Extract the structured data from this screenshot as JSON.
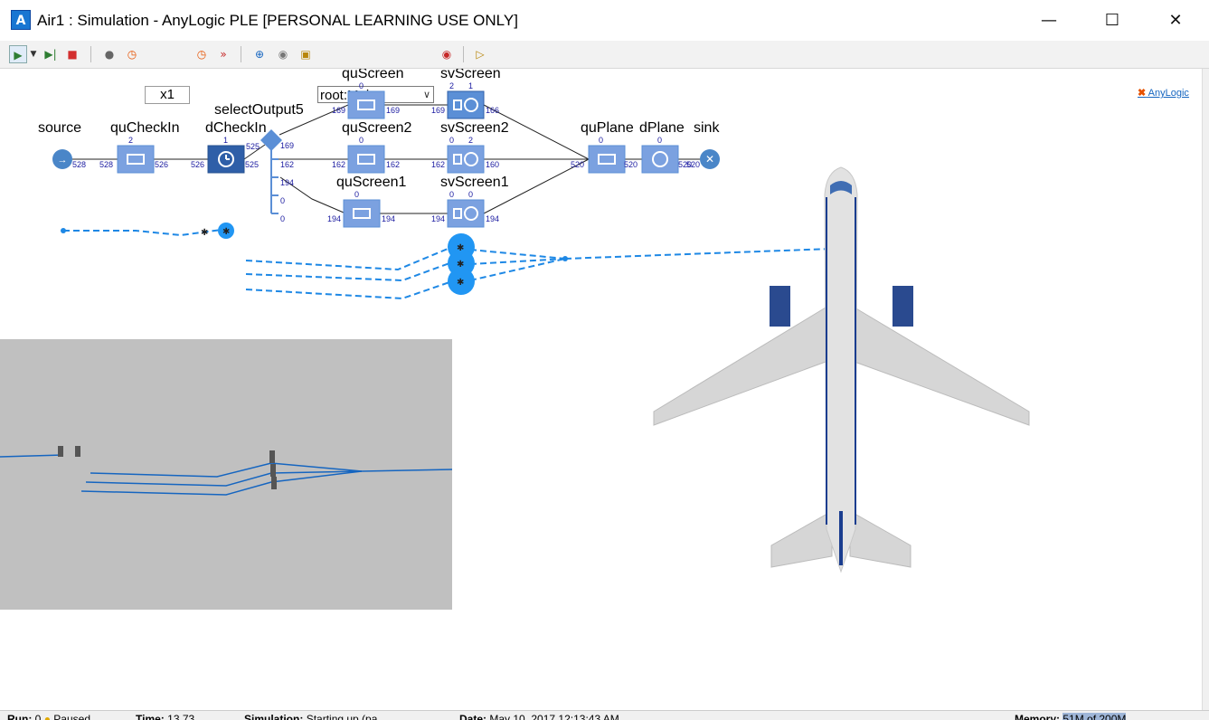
{
  "window": {
    "title": "Air1 : Simulation - AnyLogic PLE [PERSONAL LEARNING USE ONLY]",
    "minimize_icon": "minimize-icon",
    "maximize_icon": "maximize-icon",
    "close_icon": "close-icon"
  },
  "toolbar": {
    "speed": "x1",
    "experiment_select": "root:Main",
    "brand": "AnyLogic",
    "icons": [
      "run-icon",
      "run-menu-icon",
      "step-icon",
      "stop-icon",
      "agent-icon",
      "clock-icon",
      "speed-down-icon",
      "speed-up-icon",
      "navigate-icon",
      "camera-icon",
      "zoom-icon",
      "model-view-icon",
      "dev-panel-icon"
    ]
  },
  "flowchart": {
    "blocks": [
      {
        "id": "source",
        "label": "source",
        "count_top": "",
        "in": "",
        "out": "528"
      },
      {
        "id": "quCheckIn",
        "label": "quCheckIn",
        "count_top": "2",
        "in": "528",
        "out": "526"
      },
      {
        "id": "dCheckIn",
        "label": "dCheckIn",
        "count_top": "1",
        "in": "526",
        "out": "525"
      },
      {
        "id": "selectOutput5",
        "label": "selectOutput5",
        "count_top": "",
        "in": "525",
        "out": ""
      },
      {
        "id": "quScreen",
        "label": "quScreen",
        "count_top": "0",
        "in": "169",
        "out": "169"
      },
      {
        "id": "svScreen",
        "label": "svScreen",
        "count_top": "2",
        "count_top2": "1",
        "in": "169",
        "out": "166"
      },
      {
        "id": "quScreen2",
        "label": "quScreen2",
        "count_top": "0",
        "in": "162",
        "out": "162"
      },
      {
        "id": "svScreen2",
        "label": "svScreen2",
        "count_top": "0",
        "count_top2": "2",
        "in": "162",
        "out": "160"
      },
      {
        "id": "quScreen1",
        "label": "quScreen1",
        "count_top": "0",
        "in": "194",
        "out": "194"
      },
      {
        "id": "svScreen1",
        "label": "svScreen1",
        "count_top": "0",
        "count_top2": "0",
        "in": "194",
        "out": "194"
      },
      {
        "id": "quPlane",
        "label": "quPlane",
        "count_top": "0",
        "in": "520",
        "out": "520"
      },
      {
        "id": "dPlane",
        "label": "dPlane",
        "count_top": "0",
        "in": "520",
        "out": "520"
      },
      {
        "id": "sink",
        "label": "sink",
        "count_top": "",
        "in": "520",
        "out": ""
      }
    ],
    "select_outputs": [
      "169",
      "162",
      "194",
      "0",
      "0"
    ]
  },
  "statusbar": {
    "run_label": "Run:",
    "run_value": "0",
    "run_state": "Paused",
    "time_label": "Time:",
    "time_value": "13.73",
    "simulation_label": "Simulation:",
    "simulation_value": "Starting up (pa...",
    "date_label": "Date:",
    "date_value": "May 10, 2017 12:13:43 AM",
    "memory_label": "Memory:",
    "memory_value": "51M of 200M"
  },
  "colors": {
    "block_fill": "#5b8fd6",
    "block_dark": "#2f5fa8",
    "count_text": "#1a1aa0",
    "path": "#1e88e5",
    "agent": "#2196f3",
    "view3d_bg": "#c0c0c0",
    "plane_body": "#e0e0e0",
    "plane_stripe": "#1a3d8f"
  }
}
